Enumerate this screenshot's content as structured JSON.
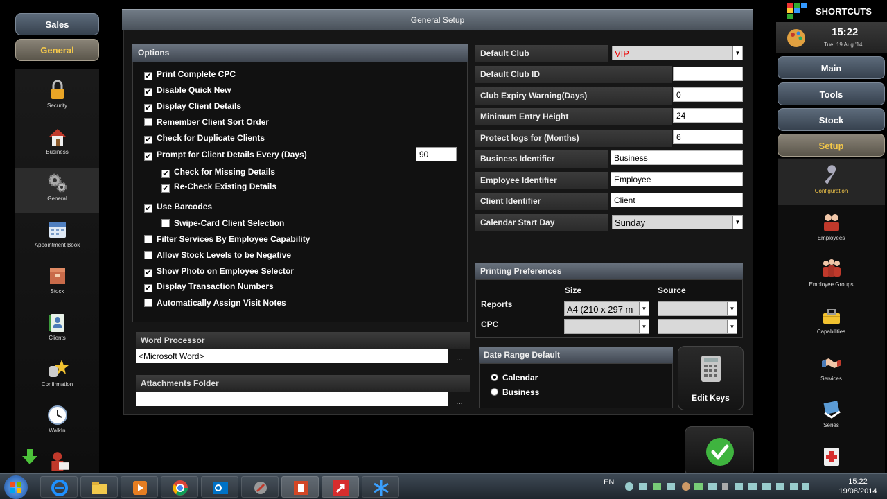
{
  "left_nav": {
    "sales": "Sales",
    "general": "General",
    "items": [
      {
        "label": "Security",
        "icon": "lock-icon"
      },
      {
        "label": "Business",
        "icon": "house-icon"
      },
      {
        "label": "General",
        "icon": "gears-icon"
      },
      {
        "label": "Appointment Book",
        "icon": "calendar-icon"
      },
      {
        "label": "Stock",
        "icon": "box-icon"
      },
      {
        "label": "Clients",
        "icon": "client-card-icon"
      },
      {
        "label": "Confirmation",
        "icon": "star-phone-icon"
      },
      {
        "label": "WalkIn",
        "icon": "clock-icon"
      }
    ]
  },
  "main": {
    "title": "General Setup",
    "options_header": "Options",
    "options": [
      {
        "label": "Print Complete CPC",
        "checked": true
      },
      {
        "label": "Disable Quick New",
        "checked": true
      },
      {
        "label": "Display Client Details",
        "checked": true
      },
      {
        "label": "Remember Client Sort Order",
        "checked": false
      },
      {
        "label": "Check for Duplicate Clients",
        "checked": true
      },
      {
        "label": "Prompt for Client Details Every (Days)",
        "checked": true
      },
      {
        "label": "Check for Missing Details",
        "checked": true
      },
      {
        "label": "Re-Check Existing Details",
        "checked": true
      },
      {
        "label": "Use Barcodes",
        "checked": true
      },
      {
        "label": "Swipe-Card Client Selection",
        "checked": false
      },
      {
        "label": "Filter Services By Employee Capability",
        "checked": false
      },
      {
        "label": "Allow Stock Levels to be Negative",
        "checked": false
      },
      {
        "label": "Show Photo on Employee Selector",
        "checked": true
      },
      {
        "label": "Display Transaction Numbers",
        "checked": true
      },
      {
        "label": "Automatically Assign Visit Notes",
        "checked": false
      }
    ],
    "prompt_days": "90",
    "word_processor": {
      "label": "Word Processor",
      "value": "<Microsoft Word>",
      "browse": "..."
    },
    "attachments": {
      "label": "Attachments Folder",
      "value": "",
      "browse": "..."
    },
    "fields": {
      "default_club": {
        "label": "Default Club",
        "value": "VIP"
      },
      "default_club_id": {
        "label": "Default Club ID",
        "value": ""
      },
      "club_expiry": {
        "label": "Club Expiry Warning(Days)",
        "value": "0"
      },
      "min_entry_height": {
        "label": "Minimum Entry Height",
        "value": "24"
      },
      "protect_logs": {
        "label": "Protect logs for (Months)",
        "value": "6"
      },
      "business_id": {
        "label": "Business Identifier",
        "value": "Business"
      },
      "employee_id": {
        "label": "Employee Identifier",
        "value": "Employee"
      },
      "client_id": {
        "label": "Client Identifier",
        "value": "Client"
      },
      "calendar_start": {
        "label": "Calendar Start Day",
        "value": "Sunday"
      }
    },
    "printing": {
      "header": "Printing Preferences",
      "size_col": "Size",
      "source_col": "Source",
      "reports_label": "Reports",
      "reports_size": "A4 (210 x 297 m",
      "cpc_label": "CPC"
    },
    "date_range": {
      "header": "Date Range Default",
      "opt_calendar": "Calendar",
      "opt_business": "Business",
      "selected": "Calendar"
    },
    "edit_keys": "Edit Keys"
  },
  "right_nav": {
    "shortcuts": "SHORTCUTS",
    "time": "15:22",
    "date": "Tue, 19 Aug '14",
    "main": "Main",
    "tools": "Tools",
    "stock": "Stock",
    "setup": "Setup",
    "items": [
      {
        "label": "Configuration",
        "icon": "wrench-icon"
      },
      {
        "label": "Employees",
        "icon": "employees-icon"
      },
      {
        "label": "Employee Groups",
        "icon": "employee-groups-icon"
      },
      {
        "label": "Capabilities",
        "icon": "toolbox-icon"
      },
      {
        "label": "Services",
        "icon": "handshake-icon"
      },
      {
        "label": "Series",
        "icon": "series-icon"
      }
    ]
  },
  "taskbar": {
    "lang": "EN",
    "time": "15:22",
    "date": "19/08/2014"
  },
  "colors": {
    "accent_gold": "#f4c84a",
    "nav_blue": "#4a5766",
    "vip_red": "#e00000",
    "ok_green": "#3fb43f"
  }
}
